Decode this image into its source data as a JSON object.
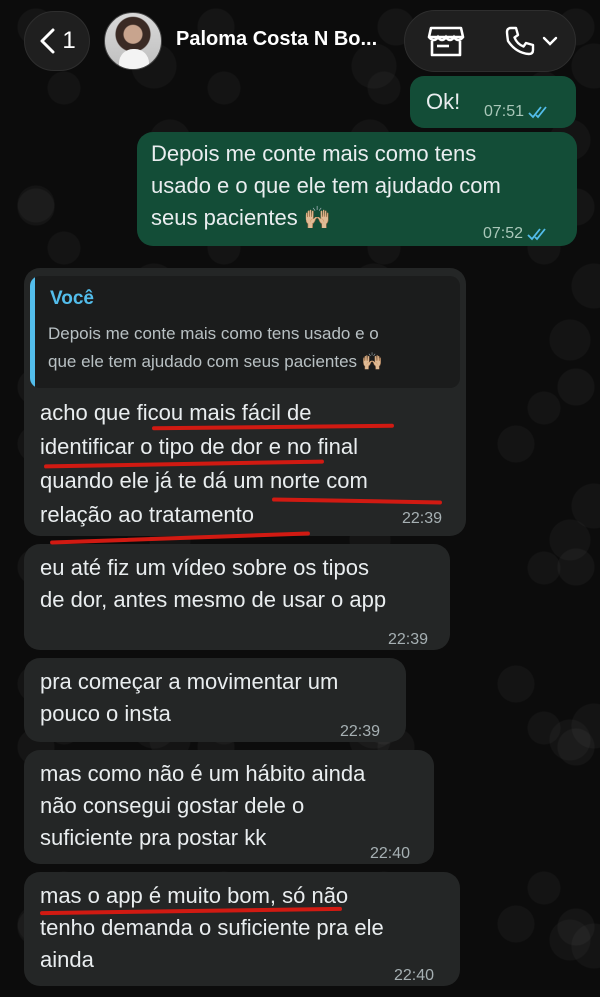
{
  "header": {
    "back_count": "1",
    "contact_name": "Paloma Costa N Bo...",
    "icons": [
      "chevron-left-icon",
      "store-icon",
      "phone-icon",
      "chevron-down-icon"
    ]
  },
  "messages": [
    {
      "direction": "out",
      "text": "Ok!",
      "time": "07:51",
      "status": "read"
    },
    {
      "direction": "out",
      "text": "Depois me conte mais como tens\nusado e o que ele tem ajudado com\nseus pacientes 🙌🏼",
      "time": "07:52",
      "status": "read"
    },
    {
      "direction": "in",
      "reply_to": {
        "author": "Você",
        "text": "Depois me conte mais como tens usado e o\nque ele tem ajudado com seus pacientes 🙌🏼"
      },
      "text": "acho que ficou mais fácil de\nidentificar o tipo de dor e no final\nquando ele já te dá um norte com\nrelação ao tratamento",
      "time": "22:39"
    },
    {
      "direction": "in",
      "text": "eu até fiz um vídeo sobre os tipos\nde dor, antes mesmo de usar o app",
      "time": "22:39"
    },
    {
      "direction": "in",
      "text": "pra começar a movimentar um\npouco o insta",
      "time": "22:39"
    },
    {
      "direction": "in",
      "text": "mas como não é um hábito ainda\nnão consegui gostar dele o\nsuficiente pra postar kk",
      "time": "22:40"
    },
    {
      "direction": "in",
      "text": "mas o app é muito bom, só não\ntenho demanda o suficiente pra ele\nainda",
      "time": "22:40"
    }
  ],
  "colors": {
    "outgoing_bubble": "#134d37",
    "incoming_bubble": "#242626",
    "quote_accent": "#53bdeb",
    "annotation_underline": "#d11a12",
    "read_ticks": "#53bdeb"
  }
}
